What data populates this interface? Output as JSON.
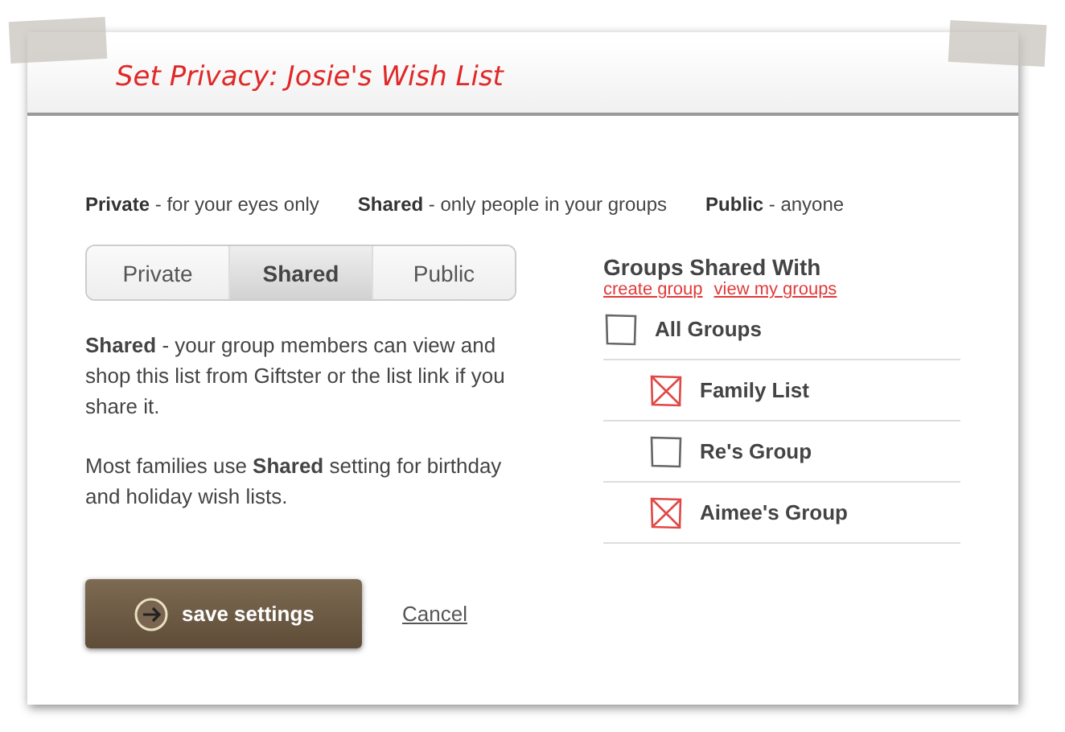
{
  "title": "Set Privacy: Josie's Wish List",
  "legend": [
    "**Private** - for your eyes only",
    "**Shared** - only people in your groups",
    "**Public** - anyone"
  ],
  "tabs": [
    {
      "label": "Private",
      "selected": false
    },
    {
      "label": "Shared",
      "selected": true
    },
    {
      "label": "Public",
      "selected": false
    }
  ],
  "description": [
    "**Shared** - your group members can view and shop this list from Giftster or the list link if you share it.",
    "Most families use **Shared** setting for birthday and holiday wish lists."
  ],
  "groups": {
    "heading": "Groups Shared With",
    "links": [
      "create group",
      "view my groups"
    ],
    "items": [
      {
        "label": "All Groups",
        "checked": false,
        "children": [
          {
            "label": "Family List",
            "checked": true
          },
          {
            "label": "Re's Group",
            "checked": false
          },
          {
            "label": "Aimee's Group",
            "checked": true
          }
        ]
      }
    ]
  },
  "save_button": "save settings",
  "cancel_link": "Cancel"
}
